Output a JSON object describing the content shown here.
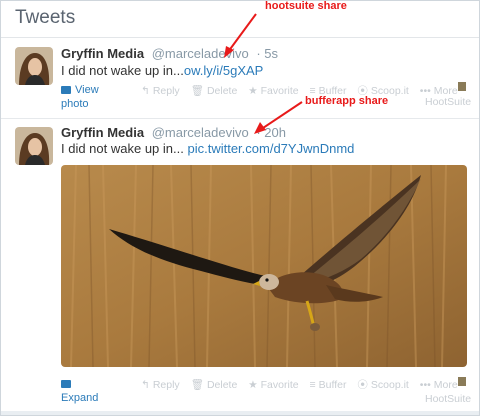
{
  "header": {
    "title": "Tweets"
  },
  "annotations": {
    "hootsuite": "hootsuite share",
    "bufferapp": "bufferapp share"
  },
  "tweets": [
    {
      "name": "Gryffin Media",
      "handle": "@marceladevivo",
      "time": "5s",
      "text": "I did not wake up in...",
      "link": "ow.ly/i/5gXAP",
      "media_label_1": "View",
      "media_label_2": "photo",
      "actions": [
        "Reply",
        "Delete",
        "Favorite",
        "Buffer",
        "Scoop.it",
        "More"
      ],
      "hootsuite": "HootSuite"
    },
    {
      "name": "Gryffin Media",
      "handle": "@marceladevivo",
      "time": "20h",
      "text": "I did not wake up in...",
      "link": "pic.twitter.com/d7YJwnDnmd",
      "media_label_1": "Expand",
      "actions": [
        "Reply",
        "Delete",
        "Favorite",
        "Buffer",
        "Scoop.it",
        "More"
      ],
      "hootsuite": "HootSuite"
    }
  ],
  "colors": {
    "accent": "#2b7bb9",
    "annotation": "#e81a1a",
    "muted": "#8899a6"
  },
  "icons": [
    "reply-icon",
    "delete-icon",
    "favorite-icon",
    "buffer-icon",
    "scoopit-icon",
    "more-icon",
    "hootsuite-owl-icon",
    "photo-icon",
    "arrow-icon"
  ]
}
